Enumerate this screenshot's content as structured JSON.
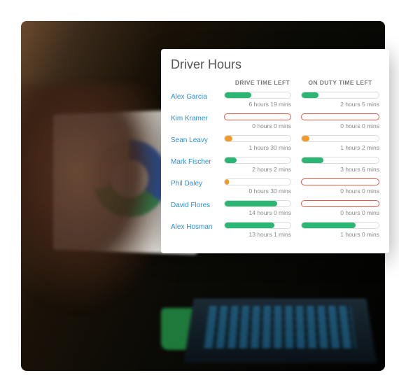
{
  "card": {
    "title": "Driver Hours",
    "headers": {
      "drive": "DRIVE TIME LEFT",
      "duty": "ON DUTY TIME LEFT"
    }
  },
  "drivers": [
    {
      "name": "Alex Garcia",
      "drive": {
        "label": "6 hours 19 mins",
        "pct": 40,
        "color": "green"
      },
      "duty": {
        "label": "2 hours 5 mins",
        "pct": 22,
        "color": "green"
      }
    },
    {
      "name": "Kim Kramer",
      "drive": {
        "label": "0 hours 0 mins",
        "pct": 0,
        "color": "empty"
      },
      "duty": {
        "label": "0 hours 0 mins",
        "pct": 0,
        "color": "empty"
      }
    },
    {
      "name": "Sean Leavy",
      "drive": {
        "label": "1 hours 30 mins",
        "pct": 12,
        "color": "orange"
      },
      "duty": {
        "label": "1 hours 2 mins",
        "pct": 10,
        "color": "orange"
      }
    },
    {
      "name": "Mark Fischer",
      "drive": {
        "label": "2 hours 2 mins",
        "pct": 18,
        "color": "green"
      },
      "duty": {
        "label": "3 hours 6 mins",
        "pct": 28,
        "color": "green"
      }
    },
    {
      "name": "Phil Daley",
      "drive": {
        "label": "0 hours 30 mins",
        "pct": 6,
        "color": "orange"
      },
      "duty": {
        "label": "0 hours 0 mins",
        "pct": 0,
        "color": "empty"
      }
    },
    {
      "name": "David Flores",
      "drive": {
        "label": "14 hours 0 mins",
        "pct": 80,
        "color": "green"
      },
      "duty": {
        "label": "0 hours 0 mins",
        "pct": 0,
        "color": "empty"
      }
    },
    {
      "name": "Alex Hosman",
      "drive": {
        "label": "13 hours 1 mins",
        "pct": 76,
        "color": "green"
      },
      "duty": {
        "label": "1 hours 0 mins",
        "pct": 70,
        "color": "green"
      }
    }
  ]
}
